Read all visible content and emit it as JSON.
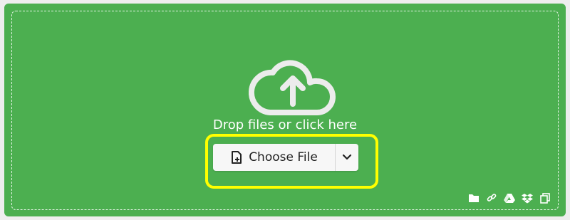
{
  "dropzone": {
    "message": "Drop files or click here",
    "cloud_icon": "cloud-upload-icon"
  },
  "choose_file": {
    "label": "Choose File",
    "icon": "file-plus-icon",
    "dropdown_icon": "chevron-down-icon"
  },
  "sources": [
    {
      "name": "folder-icon"
    },
    {
      "name": "link-icon"
    },
    {
      "name": "google-drive-icon"
    },
    {
      "name": "dropbox-icon"
    },
    {
      "name": "clipboard-icon"
    }
  ],
  "colors": {
    "background": "#4caf50",
    "highlight": "#ffff00",
    "button_bg": "#f7f7f7"
  }
}
